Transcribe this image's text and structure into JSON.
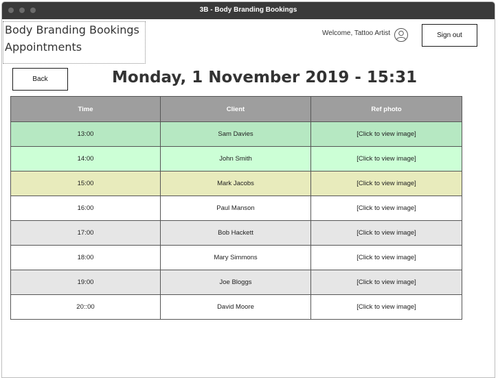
{
  "window": {
    "title": "3B - Body Branding Bookings"
  },
  "brand": {
    "line1": "Body Branding Bookings",
    "line2": "Appointments"
  },
  "header": {
    "welcome": "Welcome, Tattoo Artist",
    "signout_label": "Sign out",
    "back_label": "Back"
  },
  "page": {
    "heading": "Monday, 1 November 2019 - 15:31"
  },
  "table": {
    "headers": {
      "time": "Time",
      "client": "Client",
      "photo": "Ref photo"
    },
    "rows": [
      {
        "time": "13:00",
        "client": "Sam Davies",
        "photo": "[Click to view image]"
      },
      {
        "time": "14:00",
        "client": "John Smith",
        "photo": "[Click to view image]"
      },
      {
        "time": "15:00",
        "client": "Mark Jacobs",
        "photo": "[Click to view image]"
      },
      {
        "time": "16:00",
        "client": "Paul Manson",
        "photo": "[Click to view image]"
      },
      {
        "time": "17:00",
        "client": "Bob Hackett",
        "photo": "[Click to view image]"
      },
      {
        "time": "18:00",
        "client": "Mary Simmons",
        "photo": "[Click to view image]"
      },
      {
        "time": "19:00",
        "client": "Joe Bloggs",
        "photo": "[Click to view image]"
      },
      {
        "time": "20::00",
        "client": "David Moore",
        "photo": "[Click to view image]"
      }
    ]
  },
  "colors": {
    "titlebar": "#3a3a3a",
    "header_row": "#9e9e9e",
    "row_past": "#b6e8c2",
    "row_recent": "#ccffd6",
    "row_current": "#e8ebbc",
    "row_alt": "#e6e6e6",
    "row_default": "#ffffff"
  },
  "icons": {
    "user": "user-avatar-icon"
  }
}
